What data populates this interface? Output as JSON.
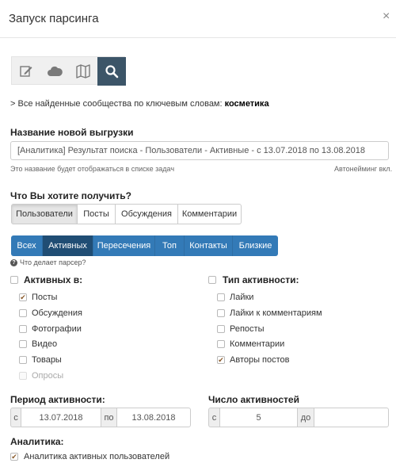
{
  "dialog": {
    "title": "Запуск парсинга",
    "close_glyph": "×"
  },
  "iconbar": [
    {
      "name": "edit-icon"
    },
    {
      "name": "cloud-icon"
    },
    {
      "name": "map-icon"
    },
    {
      "name": "search-icon",
      "active": true
    }
  ],
  "info": {
    "prefix": "> Все найденные сообщества по ключевым словам: ",
    "keyword": "косметика"
  },
  "export_name": {
    "label": "Название новой выгрузки",
    "value": "[Аналитика] Результат поиска - Пользователи - Активные - с 13.07.2018 по 13.08.2018",
    "hint": "Это название будет отображаться в списке задач",
    "autoname": "Автонейминг вкл."
  },
  "what_to_get": {
    "label": "Что Вы хотите получить?",
    "options": [
      "Пользователи",
      "Посты",
      "Обсуждения",
      "Комментарии"
    ],
    "selected": "Пользователи"
  },
  "mode_tabs": {
    "options": [
      "Всех",
      "Активных",
      "Пересечения",
      "Топ",
      "Контакты",
      "Близкие"
    ],
    "selected": "Активных"
  },
  "help_link": "Что делает парсер?",
  "active_in": {
    "title": "Активных в:",
    "items": [
      {
        "label": "Посты",
        "checked": true
      },
      {
        "label": "Обсуждения",
        "checked": false
      },
      {
        "label": "Фотографии",
        "checked": false
      },
      {
        "label": "Видео",
        "checked": false
      },
      {
        "label": "Товары",
        "checked": false
      },
      {
        "label": "Опросы",
        "checked": false,
        "disabled": true
      }
    ]
  },
  "activity_type": {
    "title": "Тип активности:",
    "items": [
      {
        "label": "Лайки",
        "checked": false
      },
      {
        "label": "Лайки к комментариям",
        "checked": false
      },
      {
        "label": "Репосты",
        "checked": false
      },
      {
        "label": "Комментарии",
        "checked": false
      },
      {
        "label": "Авторы постов",
        "checked": true
      }
    ]
  },
  "period": {
    "label": "Период активности:",
    "from_prefix": "с",
    "from": "13.07.2018",
    "to_prefix": "по",
    "to": "13.08.2018"
  },
  "count": {
    "label": "Число активностей",
    "from_prefix": "с",
    "from": "5",
    "to_prefix": "до",
    "to": ""
  },
  "analytics": {
    "label": "Аналитика:",
    "checkbox_label": "Аналитика активных пользователей",
    "checked": true
  }
}
